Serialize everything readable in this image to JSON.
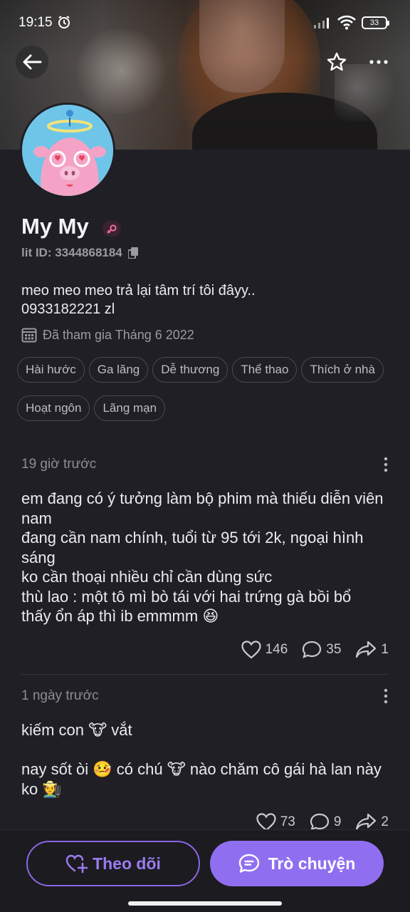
{
  "status_bar": {
    "time": "19:15",
    "battery": "33"
  },
  "profile": {
    "name": "My My",
    "lit_id": "lit ID: 3344868184",
    "bio_line1": "meo meo meo trả lại tâm trí tôi đâyy..",
    "bio_line2": "0933182221 zl",
    "joined": "Đã tham gia Tháng 6 2022",
    "tags": [
      "Hài hước",
      "Ga lăng",
      "Dễ thương",
      "Thể thao",
      "Thích ở nhà",
      "Hoạt ngôn",
      "Lãng mạn"
    ]
  },
  "posts": [
    {
      "time": "19 giờ trước",
      "text": "em đang có ý tưởng làm bộ phim mà thiếu diễn viên nam\nđang cần nam chính, tuổi từ 95 tới 2k, ngoại hình sáng\nko cần thoại nhiều chỉ cần dùng sức\nthù lao : một tô mì bò tái với hai trứng gà bồi bổ\nthấy ổn áp thì ib emmmm 😆",
      "likes": "146",
      "comments": "35",
      "shares": "1"
    },
    {
      "time": "1 ngày trước",
      "text": "kiếm con 🐮 vắt\n\nnay sốt òi 🤒 có chú 🐮  nào chăm cô gái hà lan này ko 🧑‍🌾",
      "likes": "73",
      "comments": "9",
      "shares": "2"
    }
  ],
  "actions": {
    "follow_label": "Theo dõi",
    "chat_label": "Trò chuyện"
  },
  "colors": {
    "accent": "#8f6ff0",
    "background": "#201f25"
  }
}
